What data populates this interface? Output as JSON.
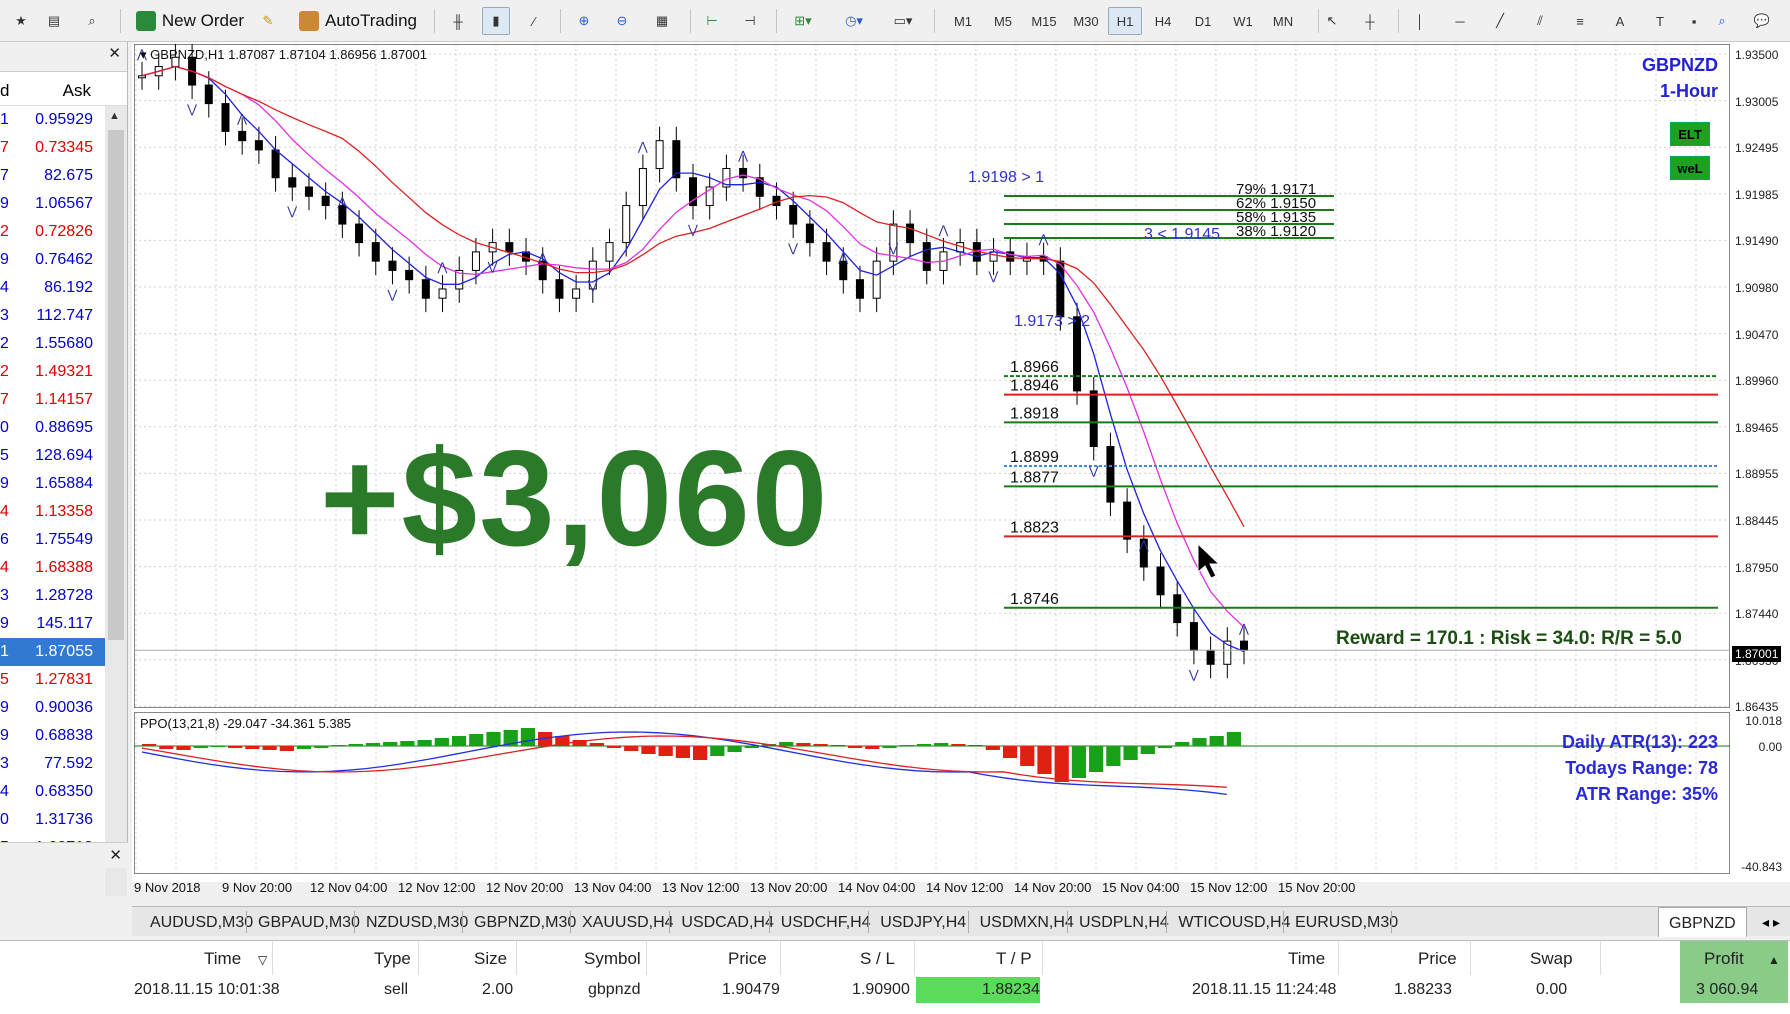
{
  "toolbar": {
    "new_order": "New Order",
    "auto_trading": "AutoTrading",
    "periods": [
      "M1",
      "M5",
      "M15",
      "M30",
      "H1",
      "H4",
      "D1",
      "W1",
      "MN"
    ],
    "active_period": "H1"
  },
  "market_watch": {
    "col1": "d",
    "col2": "Ask",
    "rows": [
      {
        "left": "1",
        "ask": "0.95929",
        "color": "#0000cc"
      },
      {
        "left": "7",
        "ask": "0.73345",
        "color": "#dd0000"
      },
      {
        "left": "7",
        "ask": "82.675",
        "color": "#0000cc"
      },
      {
        "left": "9",
        "ask": "1.06567",
        "color": "#0000cc"
      },
      {
        "left": "2",
        "ask": "0.72826",
        "color": "#dd0000"
      },
      {
        "left": "9",
        "ask": "0.76462",
        "color": "#0000cc"
      },
      {
        "left": "4",
        "ask": "86.192",
        "color": "#0000cc"
      },
      {
        "left": "3",
        "ask": "112.747",
        "color": "#0000cc"
      },
      {
        "left": "2",
        "ask": "1.55680",
        "color": "#0000cc"
      },
      {
        "left": "2",
        "ask": "1.49321",
        "color": "#dd0000"
      },
      {
        "left": "7",
        "ask": "1.14157",
        "color": "#dd0000"
      },
      {
        "left": "0",
        "ask": "0.88695",
        "color": "#0000cc"
      },
      {
        "left": "5",
        "ask": "128.694",
        "color": "#0000cc"
      },
      {
        "left": "9",
        "ask": "1.65884",
        "color": "#0000cc"
      },
      {
        "left": "4",
        "ask": "1.13358",
        "color": "#dd0000"
      },
      {
        "left": "6",
        "ask": "1.75549",
        "color": "#0000cc"
      },
      {
        "left": "4",
        "ask": "1.68388",
        "color": "#dd0000"
      },
      {
        "left": "3",
        "ask": "1.28728",
        "color": "#0000cc"
      },
      {
        "left": "9",
        "ask": "145.117",
        "color": "#0000cc"
      },
      {
        "left": "1",
        "ask": "1.87055",
        "color": "#ffffff",
        "selected": true
      },
      {
        "left": "5",
        "ask": "1.27831",
        "color": "#dd0000"
      },
      {
        "left": "9",
        "ask": "0.90036",
        "color": "#0000cc"
      },
      {
        "left": "9",
        "ask": "0.68838",
        "color": "#0000cc"
      },
      {
        "left": "3",
        "ask": "77.592",
        "color": "#0000cc"
      },
      {
        "left": "4",
        "ask": "0.68350",
        "color": "#0000cc"
      },
      {
        "left": "0",
        "ask": "1.31736",
        "color": "#0000cc"
      },
      {
        "left": "5",
        "ask": "1.00713",
        "color": "#0000cc"
      }
    ]
  },
  "chart": {
    "title": "GBPNZD,H1  1.87087 1.87104 1.86956 1.87001",
    "symbol": "GBPNZD",
    "timeframe": "1-Hour",
    "badge1": "ELT",
    "badge2": "weL",
    "big_profit": "+$3,060",
    "reward_risk": "Reward = 170.1 : Risk = 34.0: R/R = 5.0",
    "current_price": "1.87001",
    "y_ticks": [
      "1.93500",
      "1.93005",
      "1.92495",
      "1.91985",
      "1.91490",
      "1.90980",
      "1.90470",
      "1.89960",
      "1.89465",
      "1.88955",
      "1.88445",
      "1.87950",
      "1.87440",
      "1.86930",
      "1.86435"
    ],
    "x_ticks": [
      "9 Nov 2018",
      "9 Nov 20:00",
      "12 Nov 04:00",
      "12 Nov 12:00",
      "12 Nov 20:00",
      "13 Nov 04:00",
      "13 Nov 12:00",
      "13 Nov 20:00",
      "14 Nov 04:00",
      "14 Nov 12:00",
      "14 Nov 20:00",
      "15 Nov 04:00",
      "15 Nov 12:00",
      "15 Nov 20:00"
    ],
    "fib_labels": [
      "79% 1.9171",
      "62% 1.9150",
      "58% 1.9135",
      "38% 1.9120"
    ],
    "annot1": "1.9198 > 1",
    "annot2": "3 < 1.9145",
    "annot3": "1.9173 > 2",
    "level_labels": [
      "1.8966",
      "1.8946",
      "1.8918",
      "1.8899",
      "1.8877",
      "1.8823",
      "1.8746"
    ],
    "ppo_label": "PPO(13,21,8) -29.047 -34.361 5.385",
    "ppo_ticks": [
      "10.018",
      "0.00",
      "-40.843"
    ],
    "atr": {
      "line1": "Daily ATR(13): 223",
      "line2": "Todays Range: 78",
      "line3": "ATR Range: 35%"
    }
  },
  "tabs": [
    "AUDUSD,M30",
    "GBPAUD,M30",
    "NZDUSD,M30",
    "GBPNZD,M30",
    "XAUUSD,H4",
    "USDCAD,H4",
    "USDCHF,H4",
    "USDJPY,H4",
    "USDMXN,H4",
    "USDPLN,H4",
    "WTICOUSD,H4",
    "EURUSD,M30",
    "GBPNZD"
  ],
  "terminal": {
    "headers": {
      "time": "Time",
      "type": "Type",
      "size": "Size",
      "symbol": "Symbol",
      "price": "Price",
      "sl": "S / L",
      "tp": "T / P",
      "close_time": "Time",
      "close_price": "Price",
      "swap": "Swap",
      "profit": "Profit"
    },
    "row": {
      "time": "2018.11.15 10:01:38",
      "type": "sell",
      "size": "2.00",
      "symbol": "gbpnzd",
      "price": "1.90479",
      "sl": "1.90900",
      "tp": "1.88234",
      "close_time": "2018.11.15 11:24:48",
      "close_price": "1.88233",
      "swap": "0.00",
      "profit": "3 060.94"
    }
  },
  "colors": {
    "bull_candle": "#ffffff",
    "bear_candle": "#000000",
    "ma_red": "#e02020",
    "ma_magenta": "#e030e0",
    "ma_blue": "#2020e0",
    "tp_green": "#5adb5a"
  }
}
